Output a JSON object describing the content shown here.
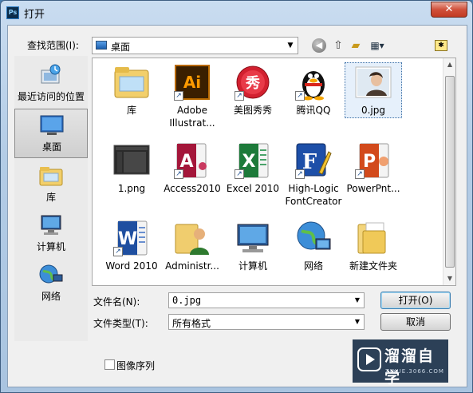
{
  "window": {
    "title": "打开",
    "app_icon_text": "Ps",
    "close_glyph": "✕"
  },
  "toolbar": {
    "look_in_label": "查找范围(I):",
    "look_in_value": "桌面",
    "icons": [
      "back-icon",
      "up-folder-icon",
      "new-folder-icon",
      "views-menu-icon",
      "pin-icon"
    ]
  },
  "places": [
    {
      "label": "最近访问的位置",
      "icon": "recent-places-icon"
    },
    {
      "label": "桌面",
      "icon": "desktop-icon",
      "selected": true
    },
    {
      "label": "库",
      "icon": "libraries-icon"
    },
    {
      "label": "计算机",
      "icon": "computer-icon"
    },
    {
      "label": "网络",
      "icon": "network-icon"
    }
  ],
  "files": [
    {
      "label": "库",
      "icon": "libraries-folder-icon"
    },
    {
      "label": "Adobe Illustrat...",
      "icon": "illustrator-icon",
      "shortcut": true
    },
    {
      "label": "美图秀秀",
      "icon": "meitu-icon",
      "shortcut": true
    },
    {
      "label": "腾讯QQ",
      "icon": "qq-penguin-icon",
      "shortcut": true
    },
    {
      "label": "0.jpg",
      "icon": "photo-thumbnail-icon",
      "selected": true
    },
    {
      "label": "1.png",
      "icon": "screenshot-thumbnail-icon"
    },
    {
      "label": "Access2010",
      "icon": "access-icon",
      "shortcut": true
    },
    {
      "label": "Excel 2010",
      "icon": "excel-icon",
      "shortcut": true
    },
    {
      "label": "High-Logic FontCreator",
      "icon": "fontcreator-icon",
      "shortcut": true
    },
    {
      "label": "PowerPnt...",
      "icon": "powerpoint-icon",
      "shortcut": true
    },
    {
      "label": "Word 2010",
      "icon": "word-icon",
      "shortcut": true
    },
    {
      "label": "Administr...",
      "icon": "user-folder-icon"
    },
    {
      "label": "计算机",
      "icon": "computer-icon"
    },
    {
      "label": "网络",
      "icon": "network-icon"
    },
    {
      "label": "新建文件夹",
      "icon": "folder-icon"
    }
  ],
  "form": {
    "filename_label": "文件名(N):",
    "filename_value": "0.jpg",
    "filetype_label": "文件类型(T):",
    "filetype_value": "所有格式",
    "open_button": "打开(O)",
    "cancel_button": "取消",
    "image_sequence_label": "图像序列",
    "image_sequence_checked": false
  },
  "watermark": {
    "name": "溜溜自学",
    "url": "ZIXUE.3066.COM"
  },
  "colors": {
    "frame": "#b3cce6",
    "selection": "#3a6ea5",
    "close": "#c23a22"
  }
}
